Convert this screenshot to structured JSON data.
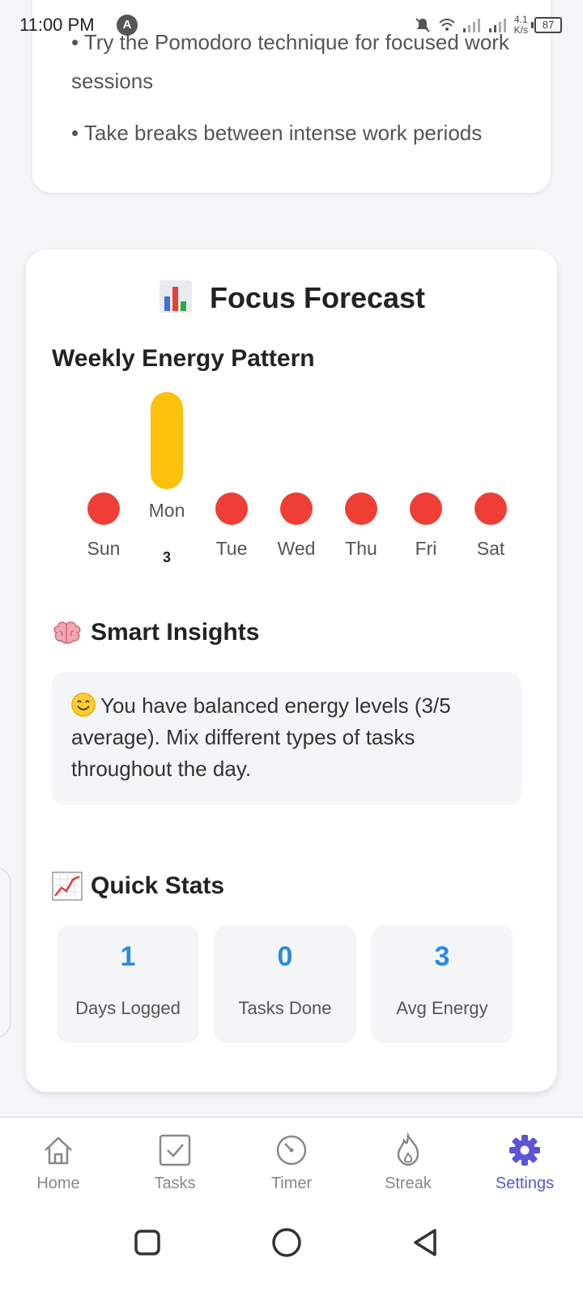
{
  "status_bar": {
    "time": "11:00 PM",
    "notification_icon": "A",
    "net_speed_value": "4.1",
    "net_speed_unit": "K/s",
    "battery": "87"
  },
  "tips": [
    "• Try the Pomodoro technique for focused work sessions",
    "• Take breaks between intense work periods"
  ],
  "forecast": {
    "title": "Focus Forecast",
    "title_icon": "bar-chart-icon",
    "weekly_heading": "Weekly Energy Pattern",
    "days": [
      {
        "label": "Sun"
      },
      {
        "label": "Mon",
        "value": "3"
      },
      {
        "label": "Tue"
      },
      {
        "label": "Wed"
      },
      {
        "label": "Thu"
      },
      {
        "label": "Fri"
      },
      {
        "label": "Sat"
      }
    ],
    "insights_heading": "Smart Insights",
    "insights_icon": "brain-icon",
    "insight_text": "You have balanced energy levels (3/5 average). Mix different types of tasks throughout the day.",
    "stats_heading": "Quick Stats",
    "stats_icon": "line-chart-icon",
    "stats": [
      {
        "value": "1",
        "label": "Days Logged"
      },
      {
        "value": "0",
        "label": "Tasks Done"
      },
      {
        "value": "3",
        "label": "Avg Energy"
      }
    ]
  },
  "chart_data": {
    "type": "bar",
    "categories": [
      "Sun",
      "Mon",
      "Tue",
      "Wed",
      "Thu",
      "Fri",
      "Sat"
    ],
    "values": [
      null,
      3,
      null,
      null,
      null,
      null,
      null
    ],
    "title": "Weekly Energy Pattern"
  },
  "bottom_nav": [
    {
      "label": "Home",
      "icon": "home-icon"
    },
    {
      "label": "Tasks",
      "icon": "tasks-icon"
    },
    {
      "label": "Timer",
      "icon": "timer-icon"
    },
    {
      "label": "Streak",
      "icon": "flame-icon"
    },
    {
      "label": "Settings",
      "icon": "gear-icon",
      "active": true
    }
  ],
  "colors": {
    "accent": "#5a55d6",
    "stat_value": "#2d8ae0",
    "low_energy": "#ef3e36",
    "mid_energy": "#fbc10b"
  }
}
